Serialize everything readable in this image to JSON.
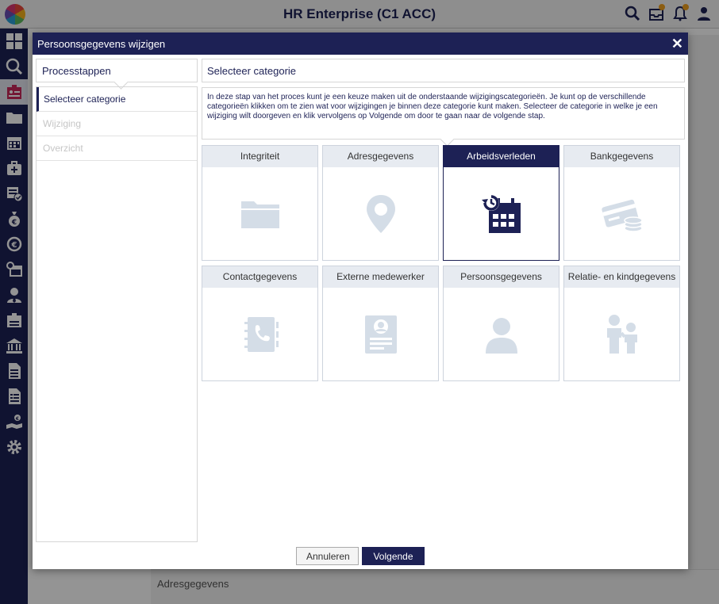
{
  "app": {
    "title": "HR Enterprise (C1 ACC)",
    "top_icons": [
      "search-icon",
      "inbox-icon",
      "bell-icon",
      "user-icon"
    ]
  },
  "sidebar": {
    "icons": [
      "dashboard-icon",
      "search-icon",
      "id-card-icon",
      "folder-icon",
      "calendar-icon",
      "first-aid-icon",
      "checklist-icon",
      "money-bag-icon",
      "euro-history-icon",
      "calendar-history-icon",
      "user-tie-icon",
      "badge-icon",
      "bank-icon",
      "document-icon",
      "document-list-icon",
      "payment-user-icon",
      "settings-icon"
    ],
    "active_index": 2
  },
  "background": {
    "panel_label": "Adresgegevens"
  },
  "modal": {
    "title": "Persoonsgegevens wijzigen",
    "close_symbol": "✕",
    "steps_header": "Processtappen",
    "steps": [
      {
        "label": "Selecteer categorie",
        "state": "current"
      },
      {
        "label": "Wijziging",
        "state": "disabled"
      },
      {
        "label": "Overzicht",
        "state": "disabled"
      }
    ],
    "category_header": "Selecteer categorie",
    "intro_text": "In deze stap van het proces kunt je een keuze maken uit de onderstaande wijzigingscategorieën. Je kunt op de verschillende categorieën klikken om te zien wat voor wijzigingen je binnen deze categorie kunt maken. Selecteer de categorie in welke je een wijziging wilt doorgeven en klik vervolgens op Volgende om door te gaan naar de volgende stap.",
    "categories": [
      {
        "label": "Integriteit",
        "icon": "folder-icon"
      },
      {
        "label": "Adresgegevens",
        "icon": "location-pin-icon"
      },
      {
        "label": "Arbeidsverleden",
        "icon": "calendar-history-icon",
        "selected": true
      },
      {
        "label": "Bankgegevens",
        "icon": "bank-card-coins-icon"
      },
      {
        "label": "Contactgegevens",
        "icon": "phonebook-icon"
      },
      {
        "label": "Externe medewerker",
        "icon": "id-badge-icon"
      },
      {
        "label": "Persoonsgegevens",
        "icon": "person-icon"
      },
      {
        "label": "Relatie- en kindgegevens",
        "icon": "parent-child-icon"
      }
    ],
    "buttons": {
      "cancel": "Annuleren",
      "next": "Volgende"
    }
  },
  "colors": {
    "brand": "#1d2155",
    "tile_header": "#e7ebf1",
    "icon_muted": "#d4dde7"
  }
}
